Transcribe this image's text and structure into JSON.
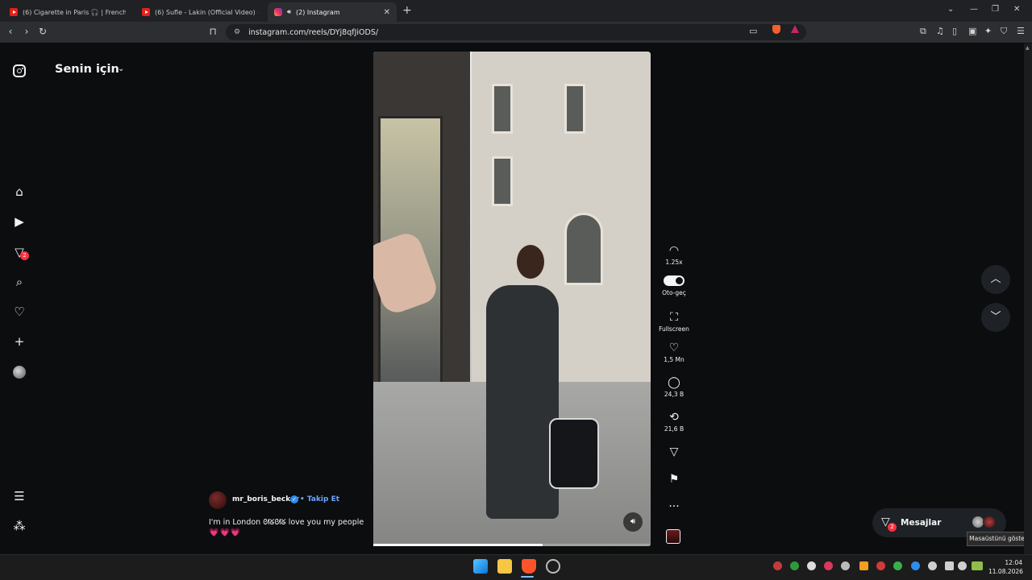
{
  "browser": {
    "tabs": [
      {
        "title": "(6) Cigarette in Paris 🎧 | French Emo",
        "favicon": "youtube-icon",
        "active": false
      },
      {
        "title": "(6) Sufle - Lakin (Official Video) - You",
        "favicon": "youtube-icon",
        "active": false
      },
      {
        "title": "(2) Instagram",
        "favicon": "instagram-icon",
        "active": true,
        "audio": true
      }
    ],
    "new_tab": "+",
    "url": "instagram.com/reels/DYj8qfJiODS/",
    "accent_brave": "#f06030"
  },
  "instagram": {
    "feed_selector": "Senin için",
    "nav": {
      "messages_badge": "2"
    },
    "reel": {
      "actions": {
        "speed": "1.25x",
        "autoplay": "Oto-geç",
        "fullscreen": "Fullscreen",
        "likes": "1,5 Mn",
        "comments": "24,3 B",
        "reposts": "21,6 B"
      },
      "progress": 0.61,
      "author": "mr_boris_becker",
      "follow": "Takip Et",
      "caption": "I'm in London ᘛᘜᘛᘜ love you my people",
      "hearts": "💗💗💗"
    },
    "messages": {
      "label": "Mesajlar",
      "badge": "2"
    }
  },
  "tooltip": "Masaüstünü göster",
  "taskbar": {
    "time": "12:04",
    "date": "11.08.2026"
  }
}
